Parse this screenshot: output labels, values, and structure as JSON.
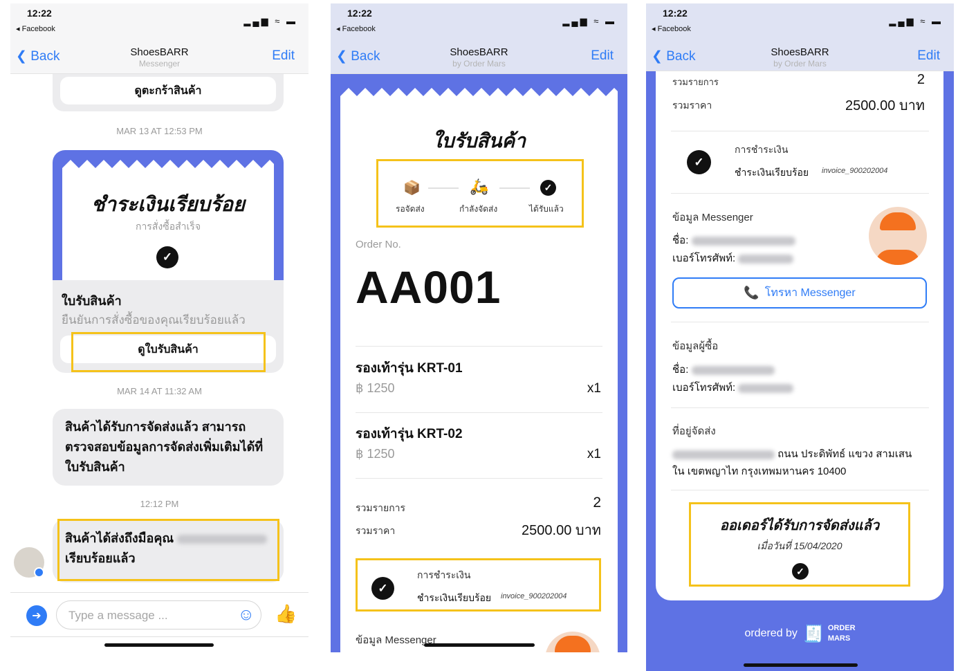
{
  "status": {
    "time": "12:22",
    "back_app": "◂ Facebook",
    "signal": "▂▄▆ ≈ ▬"
  },
  "nav": {
    "back": "Back",
    "edit": "Edit"
  },
  "s1": {
    "title": "ShoesBARR",
    "subtitle": "Messenger",
    "cart_btn": "ดูตะกร้าสินค้า",
    "ts1": "MAR 13 AT 12:53 PM",
    "card_heading": "ชำระเงินเรียบร้อย",
    "card_sub": "การสั่งซื้อสำเร็จ",
    "card_title": "ใบรับสินค้า",
    "card_desc": "ยืนยันการสั่งซื้อของคุณเรียบร้อยแล้ว",
    "receipt_btn": "ดูใบรับสินค้า",
    "ts2": "MAR 14 AT 11:32 AM",
    "msg1": "สินค้าได้รับการจัดส่งแล้ว สามารถตรวจสอบข้อมูลการจัดส่งเพิ่มเติมได้ที่ใบรับสินค้า",
    "ts3": "12:12 PM",
    "msg2a": "สินค้าได้ส่งถึงมือคุณ",
    "msg2b": "เรียบร้อยแล้ว",
    "input_placeholder": "Type a message ..."
  },
  "s2": {
    "title": "ShoesBARR",
    "subtitle": "by Order Mars",
    "receipt_title": "ใบรับสินค้า",
    "steps": [
      "รอจัดส่ง",
      "กำลังจัดส่ง",
      "ได้รับแล้ว"
    ],
    "order_label": "Order No.",
    "order_no": "AA001",
    "items": [
      {
        "name": "รองเท้ารุ่น KRT-01",
        "price": "฿ 1250",
        "qty": "x1"
      },
      {
        "name": "รองเท้ารุ่น KRT-02",
        "price": "฿ 1250",
        "qty": "x1"
      }
    ],
    "total_items_label": "รวมรายการ",
    "total_items": "2",
    "total_price_label": "รวมราคา",
    "total_price": "2500.00 บาท",
    "payment_label": "การชำระเงิน",
    "payment_status": "ชำระเงินเรียบร้อย",
    "invoice": "invoice_900202004",
    "messenger_label": "ข้อมูล Messenger"
  },
  "s3": {
    "title": "ShoesBARR",
    "subtitle": "by Order Mars",
    "total_items_label": "รวมรายการ",
    "total_items": "2",
    "total_price_label": "รวมราคา",
    "total_price": "2500.00 บาท",
    "payment_label": "การชำระเงิน",
    "payment_status": "ชำระเงินเรียบร้อย",
    "invoice": "invoice_900202004",
    "messenger_label": "ข้อมูล Messenger",
    "name_label": "ชื่อ:",
    "phone_label": "เบอร์โทรศัพท์:",
    "call_btn": "โทรหา Messenger",
    "buyer_label": "ข้อมูลผู้ซื้อ",
    "address_label": "ที่อยู่จัดส่ง",
    "address_line1": "ถนน ประดิพัทธ์ แขวง สามเสน",
    "address_line2": "ใน เขตพญาไท กรุงเทพมหานคร 10400",
    "shipped_title": "ออเดอร์ได้รับการจัดส่งแล้ว",
    "shipped_date": "เมื่อวันที่ 15/04/2020",
    "ordered_by": "ordered by",
    "brand_top": "ORDER",
    "brand_bottom": "MARS"
  },
  "colors": {
    "accent": "#5e72e4",
    "highlight": "#f5c21a",
    "link": "#2f7cf6"
  }
}
